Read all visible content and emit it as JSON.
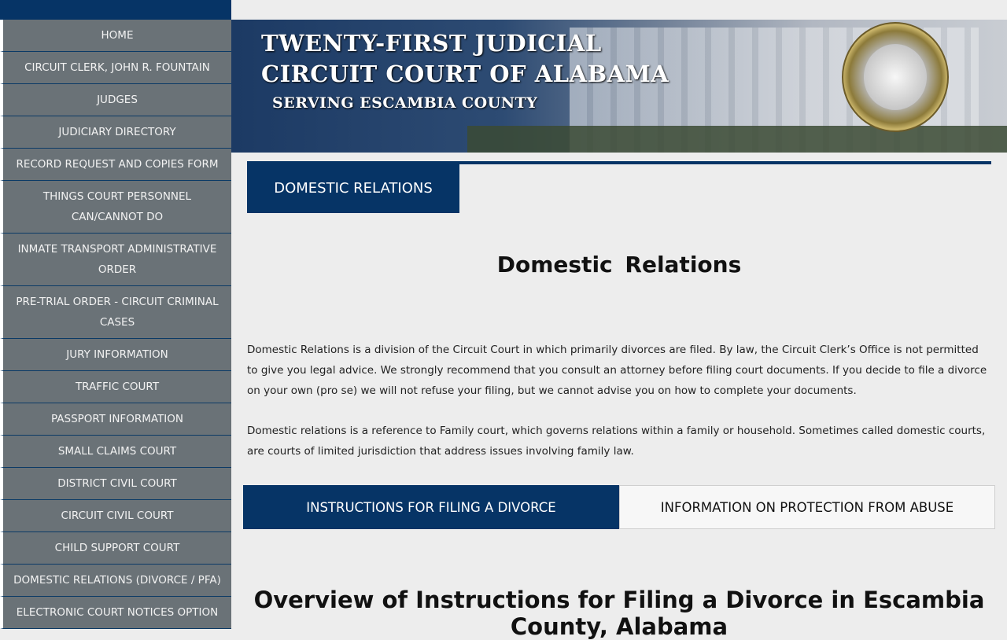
{
  "banner": {
    "title_line1": "TWENTY-FIRST JUDICIAL",
    "title_line2": "CIRCUIT COURT OF ALABAMA",
    "subtitle": "SERVING ESCAMBIA COUNTY"
  },
  "sidebar": {
    "items": [
      {
        "label": "HOME"
      },
      {
        "label": "CIRCUIT CLERK, JOHN R. FOUNTAIN"
      },
      {
        "label": "JUDGES"
      },
      {
        "label": "JUDICIARY DIRECTORY"
      },
      {
        "label": "RECORD REQUEST AND COPIES FORM"
      },
      {
        "label": "THINGS COURT PERSONNEL CAN/CANNOT DO"
      },
      {
        "label": "INMATE TRANSPORT ADMINISTRATIVE ORDER"
      },
      {
        "label": "PRE-TRIAL ORDER - CIRCUIT CRIMINAL CASES"
      },
      {
        "label": "JURY INFORMATION"
      },
      {
        "label": "TRAFFIC COURT"
      },
      {
        "label": "PASSPORT INFORMATION"
      },
      {
        "label": "SMALL CLAIMS COURT"
      },
      {
        "label": "DISTRICT CIVIL COURT"
      },
      {
        "label": "CIRCUIT CIVIL COURT"
      },
      {
        "label": "CHILD SUPPORT COURT"
      },
      {
        "label": "DOMESTIC RELATIONS (DIVORCE / PFA)"
      },
      {
        "label": "ELECTRONIC COURT NOTICES OPTION"
      }
    ]
  },
  "main": {
    "section_tab": "DOMESTIC RELATIONS",
    "page_title": "Domestic Relations",
    "paragraph1": "Domestic Relations is a division of the Circuit Court in which primarily divorces are filed. By law, the Circuit Clerk’s Office is not permitted to give you legal advice. We strongly recommend that you consult an attorney before filing court documents. If you decide to file a divorce on your own (pro se) we will not refuse your filing, but we cannot advise you on how to complete your documents.",
    "paragraph2": "Domestic relations is a reference to Family court, which governs relations within a family or household. Sometimes called domestic courts, are courts of limited jurisdiction that address issues involving family law.",
    "tabs": [
      {
        "label": "INSTRUCTIONS FOR FILING A DIVORCE"
      },
      {
        "label": "INFORMATION ON PROTECTION FROM ABUSE"
      }
    ],
    "overview_heading": "Overview of Instructions for Filing a Divorce in Escambia County, Alabama"
  },
  "colors": {
    "navy": "#063466",
    "sidebar_gray": "#6a7277",
    "page_bg": "#ededed"
  }
}
